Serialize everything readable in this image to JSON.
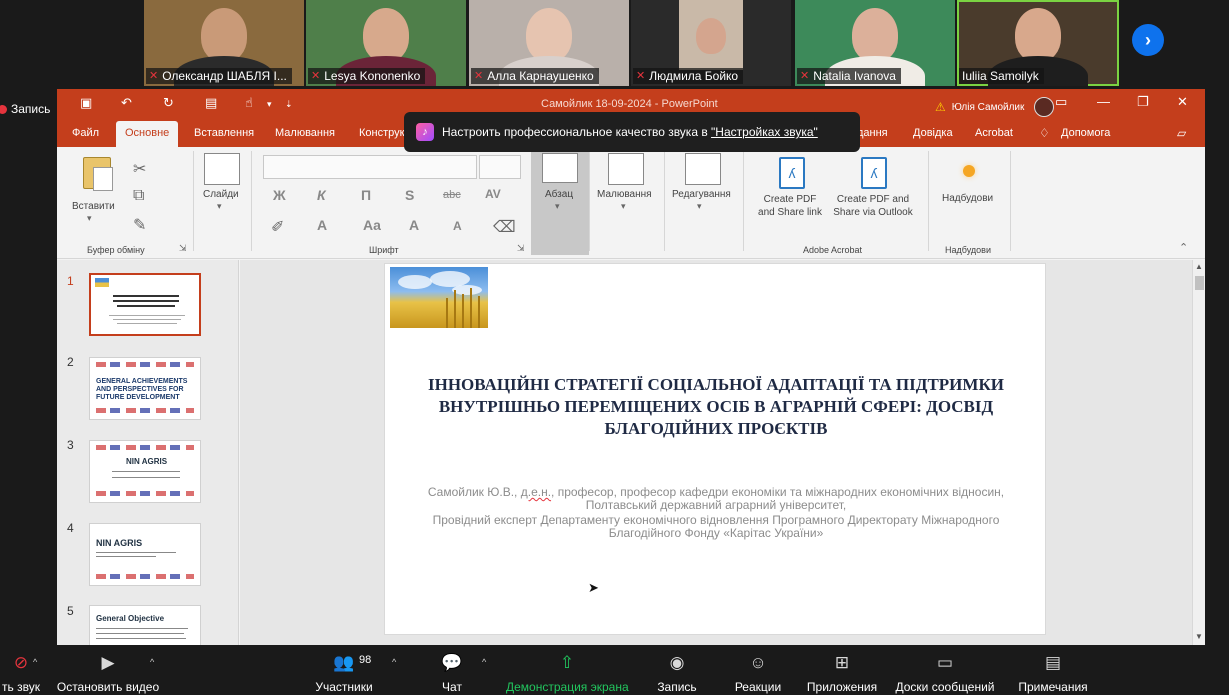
{
  "participants": [
    {
      "name": "Олександр ШАБЛЯ І..."
    },
    {
      "name": "Lesya Kononenko"
    },
    {
      "name": "Алла Карнаушенко"
    },
    {
      "name": "Людмила Бойко"
    },
    {
      "name": "Natalia Ivanova"
    },
    {
      "name": "Iuliia Samoilyk"
    }
  ],
  "recording": {
    "label": "Запись"
  },
  "ppt": {
    "doc_title": "Самойлик 18-09-2024 - PowerPoint",
    "user_name": "Юлія Самойлик",
    "tabs": [
      "Файл",
      "Основне",
      "Вставлення",
      "Малювання",
      "Конструк",
      "дання",
      "Довідка",
      "Acrobat",
      "Допомога"
    ],
    "ribbon": {
      "paste": "Вставити",
      "clipboard_group": "Буфер обміну",
      "slides": "Слайди",
      "font_group": "Шрифт",
      "bold": "Ж",
      "italic": "К",
      "underline": "П",
      "shadow": "S",
      "strike": "abc",
      "spacing": "AV",
      "font_color": "A",
      "case": "Aa",
      "grow": "A",
      "shrink": "A",
      "paragraph": "Абзац",
      "drawing": "Малювання",
      "editing": "Редагування",
      "create_pdf": "Create PDF and Share link",
      "create_pdf_outlook": "Create PDF and Share via Outlook",
      "acrobat_group": "Adobe Acrobat",
      "addins": "Надбудови",
      "addins_group": "Надбудови"
    },
    "thumb_numbers": [
      "1",
      "2",
      "3",
      "4",
      "5"
    ],
    "thumb_texts": {
      "t2": "GENERAL ACHIEVEMENTS AND PERSPECTIVES FOR FUTURE DEVELOPMENT",
      "t3": "NIN AGRIS",
      "t4": "NIN AGRIS",
      "t5": "General Objective"
    },
    "slide": {
      "title": "ІННОВАЦІЙНІ СТРАТЕГІЇ СОЦІАЛЬНОЇ АДАПТАЦІЇ ТА ПІДТРИМКИ ВНУТРІШНЬО ПЕРЕМІЩЕНИХ ОСІБ В АГРАРНІЙ СФЕРІ: ДОСВІД БЛАГОДІЙНИХ ПРОЄКТІВ",
      "author_pre": "Самойлик Ю.В., ",
      "author_degree": "д.е.н.",
      "author_post": ", професор, професор кафедри економіки та міжнародних економічних відносин, Полтавський державний аграрний університет,",
      "position": "Провідний експерт Департаменту економічного відновлення Програмного Директорату Міжнародного Благодійного Фонду «Карітас України»"
    }
  },
  "notification": {
    "text": "Настроить профессиональное качество звука в ",
    "link": "\"Настройках звука\""
  },
  "zoom_bar": {
    "audio": "ть звук",
    "video": "Остановить видео",
    "participants": "Участники",
    "participants_count": "98",
    "chat": "Чат",
    "share": "Демонстрация экрана",
    "record": "Запись",
    "reactions": "Реакции",
    "apps": "Приложения",
    "whiteboards": "Доски сообщений",
    "notes": "Примечания"
  }
}
